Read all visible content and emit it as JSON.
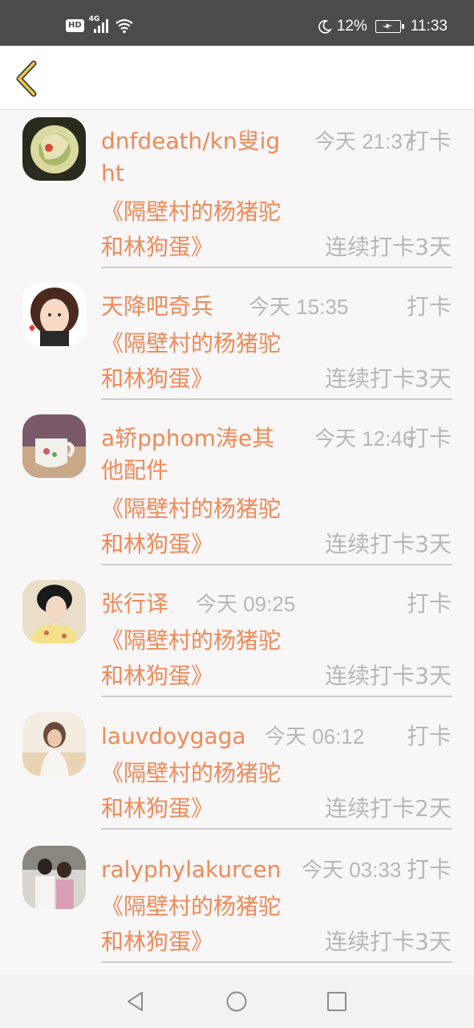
{
  "status_bar": {
    "network_badge": "HD",
    "network_gen": "4G",
    "battery_percent": "12%",
    "time": "11:33",
    "icons": [
      "signal-icon",
      "wifi-icon",
      "moon-icon",
      "battery-charging-icon"
    ]
  },
  "header": {
    "back_icon": "chevron-left-icon"
  },
  "entries": [
    {
      "name": "dnfdeath/kn叟ight",
      "time": "今天 21:37",
      "checkin": "打卡",
      "book": "《隔壁村的杨猪驼和林狗蛋》",
      "streak": "连续打卡3天"
    },
    {
      "name": "天降吧奇兵",
      "time": "今天 15:35",
      "checkin": "打卡",
      "book": "《隔壁村的杨猪驼和林狗蛋》",
      "streak": "连续打卡3天"
    },
    {
      "name": "a轿pphom涛e其他配件",
      "time": "今天 12:46",
      "checkin": "打卡",
      "book": "《隔壁村的杨猪驼和林狗蛋》",
      "streak": "连续打卡3天"
    },
    {
      "name": "张行译",
      "time": "今天 09:25",
      "checkin": "打卡",
      "book": "《隔壁村的杨猪驼和林狗蛋》",
      "streak": "连续打卡3天"
    },
    {
      "name": "lauvdoygaga",
      "time": "今天 06:12",
      "checkin": "打卡",
      "book": "《隔壁村的杨猪驼和林狗蛋》",
      "streak": "连续打卡2天"
    },
    {
      "name": "ralyphylakurcen",
      "time": "今天 03:33",
      "checkin": "打卡",
      "book": "《隔壁村的杨猪驼和林狗蛋》",
      "streak": "连续打卡3天"
    }
  ],
  "nav_bar": {
    "icons": [
      "back-triangle-icon",
      "home-circle-icon",
      "recents-square-icon"
    ]
  },
  "colors": {
    "accent": "#ee8a57",
    "muted": "#b9b6b6",
    "status_bar": "#4b4b4b",
    "back_icon": "#e8c64a"
  }
}
